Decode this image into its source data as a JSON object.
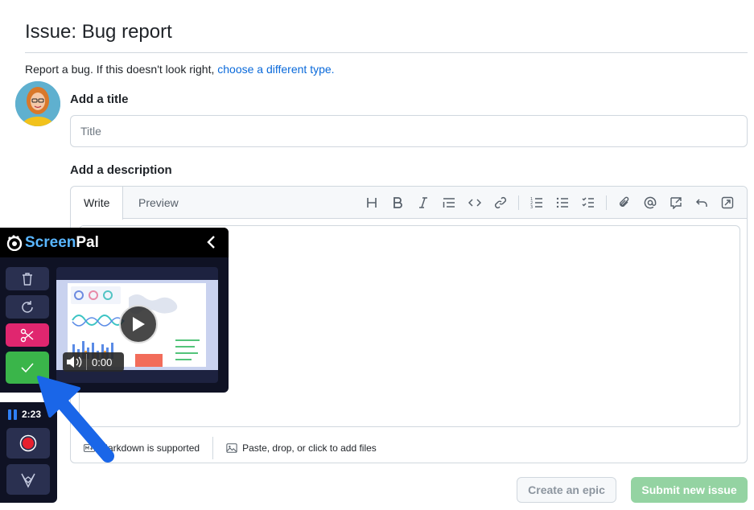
{
  "page": {
    "title": "Issue: Bug report",
    "subtitle_text": "Report a bug. If this doesn't look right, ",
    "subtitle_link": "choose a different type."
  },
  "form": {
    "title_label": "Add a title",
    "title_placeholder": "Title",
    "description_label": "Add a description",
    "tabs": [
      "Write",
      "Preview"
    ],
    "toolbar_icons": [
      "heading-icon",
      "bold-icon",
      "italic-icon",
      "quote-icon",
      "code-icon",
      "link-icon",
      "ordered-list-icon",
      "unordered-list-icon",
      "task-list-icon",
      "attach-icon",
      "mention-icon",
      "reference-icon",
      "undo-icon",
      "fullscreen-icon"
    ],
    "markdown_note": "Markdown is supported",
    "attach_note": "Paste, drop, or click to add files"
  },
  "actions": {
    "epic_label": "Create an epic",
    "submit_label": "Submit new issue"
  },
  "screenpal": {
    "brand_prefix": "Screen",
    "brand_suffix": "Pal",
    "video_time": "0:00",
    "rec_time": "2:23"
  },
  "colors": {
    "link": "#0969da",
    "submit": "#94d3a2",
    "sp_cut": "#e0266f",
    "sp_done": "#3ab54a",
    "arrow": "#1a66e8"
  }
}
